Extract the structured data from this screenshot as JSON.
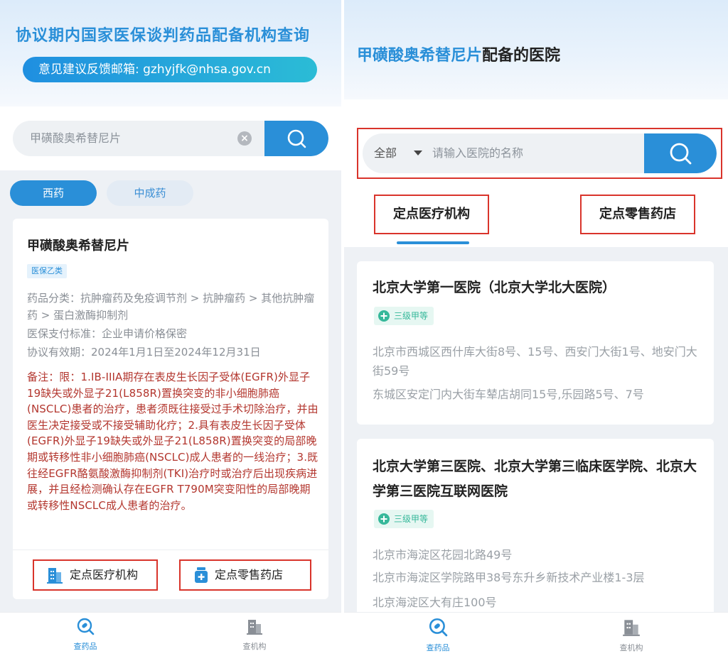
{
  "left": {
    "title": "协议期内国家医保谈判药品配备机构查询",
    "email": "意见建议反馈邮箱: gzhyjfk@nhsa.gov.cn",
    "search": {
      "value": "甲磺酸奥希替尼片"
    },
    "tabs": [
      {
        "label": "西药"
      },
      {
        "label": "中成药"
      }
    ],
    "drug": {
      "name": "甲磺酸奥希替尼片",
      "tag": "医保乙类",
      "category": "药品分类：抗肿瘤药及免疫调节剂 > 抗肿瘤药 > 其他抗肿瘤药 > 蛋白激酶抑制剂",
      "payment": "医保支付标准：企业申请价格保密",
      "validity": "协议有效期：2024年1月1日至2024年12月31日",
      "remark": "备注：限：1.IB-IIIA期存在表皮生长因子受体(EGFR)外显子19缺失或外显子21(L858R)置换突变的非小细胞肺癌(NSCLC)患者的治疗，患者须既往接受过手术切除治疗，并由医生决定接受或不接受辅助化疗；2.具有表皮生长因子受体(EGFR)外显子19缺失或外显子21(L858R)置换突变的局部晚期或转移性非小细胞肺癌(NSCLC)成人患者的一线治疗；3.既往经EGFR酪氨酸激酶抑制剂(TKI)治疗时或治疗后出现疾病进展，并且经检测确认存在EGFR T790M突变阳性的局部晚期或转移性NSCLC成人患者的治疗。",
      "btn_medical": "定点医疗机构",
      "btn_pharmacy": "定点零售药店"
    },
    "nav": [
      {
        "label": "查药品"
      },
      {
        "label": "查机构"
      }
    ]
  },
  "right": {
    "title_highlight": "甲磺酸奥希替尼片",
    "title_suffix": "配备的医院",
    "search": {
      "scope": "全部",
      "placeholder": "请输入医院的名称"
    },
    "tabs": [
      {
        "label": "定点医疗机构"
      },
      {
        "label": "定点零售药店"
      }
    ],
    "hospitals": [
      {
        "name": "北京大学第一医院（北京大学北大医院）",
        "grade": "三级甲等",
        "addresses": [
          "北京市西城区西什库大街8号、15号、西安门大街1号、地安门大街59号",
          "东城区安定门内大街车辇店胡同15号,乐园路5号、7号"
        ]
      },
      {
        "name": "北京大学第三医院、北京大学第三临床医学院、北京大学第三医院互联网医院",
        "grade": "三级甲等",
        "addresses": [
          "北京市海淀区花园北路49号",
          "北京市海淀区学院路甲38号东升乡新技术产业楼1-3层",
          "北京海淀区大有庄100号"
        ]
      }
    ],
    "nav": [
      {
        "label": "查药品"
      },
      {
        "label": "查机构"
      }
    ]
  },
  "colors": {
    "primary": "#2a8fd8",
    "highlight_border": "#d9342b",
    "remark_text": "#b3362e",
    "grade_green": "#36b89a"
  },
  "icons": {
    "search": "search-icon",
    "clear": "clear-icon",
    "hospital": "hospital-icon",
    "pharmacy": "pharmacy-icon",
    "nav_drug": "pill-search-icon",
    "nav_org": "building-icon"
  }
}
